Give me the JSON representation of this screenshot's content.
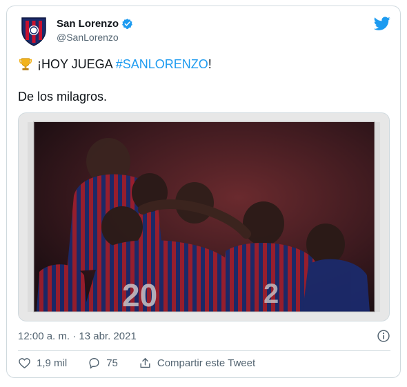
{
  "tweet": {
    "author_name": "San Lorenzo",
    "author_handle": "@SanLorenzo",
    "line1_prefix": "¡HOY JUEGA ",
    "hashtag": "#SANLORENZO",
    "line1_suffix": "!",
    "line2": "De los milagros.",
    "timestamp": "12:00 a. m. · 13 abr. 2021"
  },
  "actions": {
    "likes": "1,9 mil",
    "replies": "75",
    "share_label": "Compartir este Tweet"
  },
  "icons": {
    "verified": "verified-badge-icon",
    "platform": "twitter-bird-icon",
    "emoji": "trophy-icon",
    "info": "info-icon",
    "like": "heart-icon",
    "reply": "reply-bubble-icon",
    "share": "share-icon"
  },
  "colors": {
    "accent": "#1d9bf0",
    "text": "#0f1419",
    "muted": "#536471",
    "border": "#cfd9de",
    "club_blue": "#1b2a6b",
    "club_red": "#c8102e"
  }
}
